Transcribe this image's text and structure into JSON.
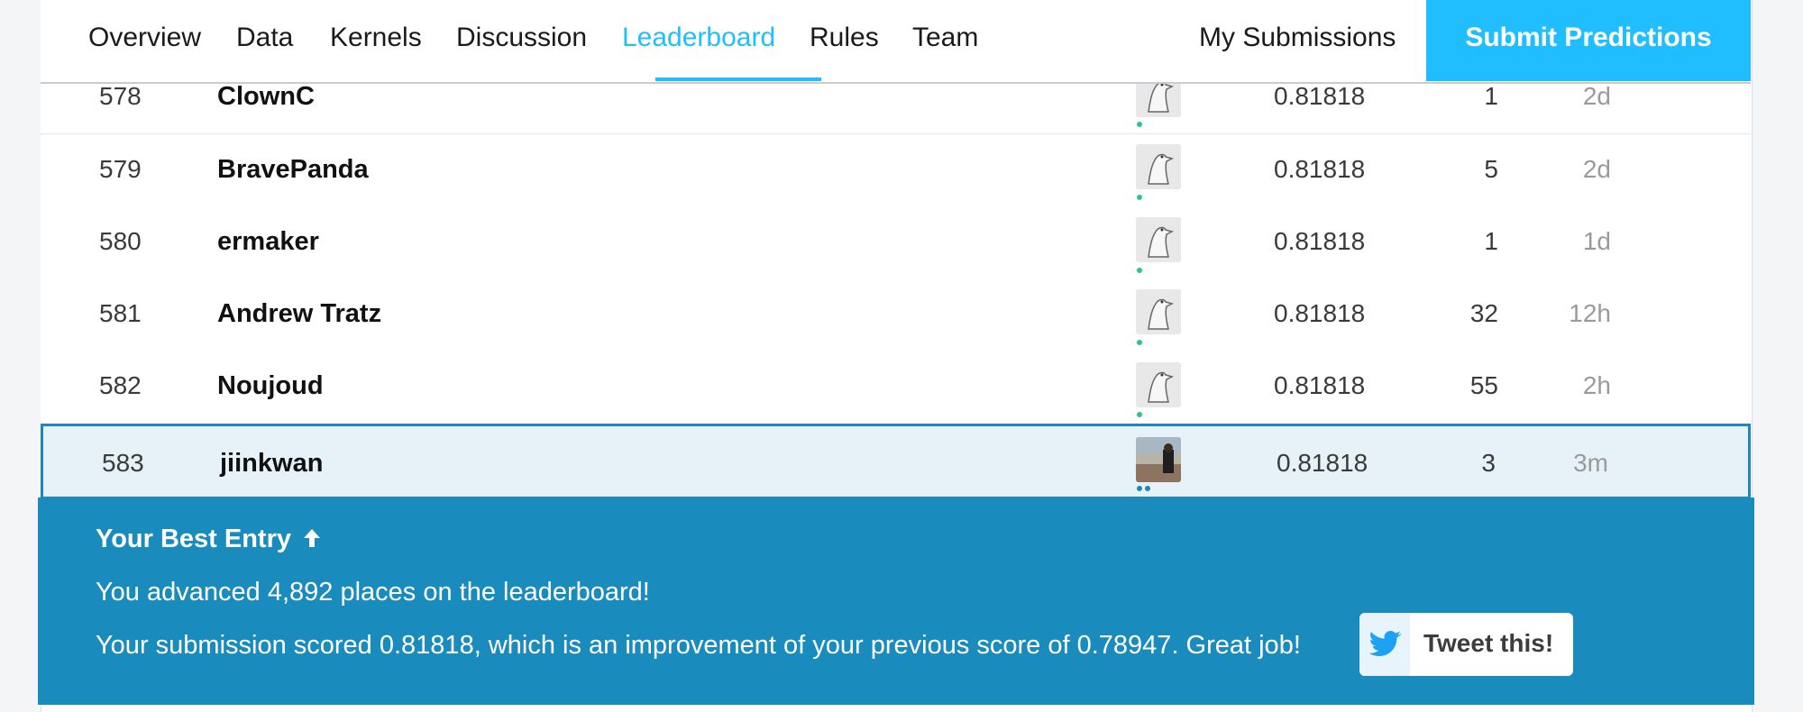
{
  "tabs": [
    {
      "label": "Overview",
      "active": false
    },
    {
      "label": "Data",
      "active": false
    },
    {
      "label": "Kernels",
      "active": false
    },
    {
      "label": "Discussion",
      "active": false
    },
    {
      "label": "Leaderboard",
      "active": true
    },
    {
      "label": "Rules",
      "active": false
    },
    {
      "label": "Team",
      "active": false
    }
  ],
  "header": {
    "my_submissions": "My Submissions",
    "submit_predictions": "Submit Predictions"
  },
  "rows": [
    {
      "rank": "578",
      "name": "ClownC",
      "score": "0.81818",
      "entries": "1",
      "last": "2d",
      "avatar": "goose-avatar"
    },
    {
      "rank": "579",
      "name": "BravePanda",
      "score": "0.81818",
      "entries": "5",
      "last": "2d",
      "avatar": "goose-avatar"
    },
    {
      "rank": "580",
      "name": "ermaker",
      "score": "0.81818",
      "entries": "1",
      "last": "1d",
      "avatar": "goose-avatar"
    },
    {
      "rank": "581",
      "name": "Andrew Tratz",
      "score": "0.81818",
      "entries": "32",
      "last": "12h",
      "avatar": "goose-avatar"
    },
    {
      "rank": "582",
      "name": "Noujoud",
      "score": "0.81818",
      "entries": "55",
      "last": "2h",
      "avatar": "goose-avatar"
    },
    {
      "rank": "583",
      "name": "jiinkwan",
      "score": "0.81818",
      "entries": "3",
      "last": "3m",
      "avatar": "photo-avatar",
      "highlight": true
    }
  ],
  "best_entry": {
    "title": "Your Best Entry",
    "arrow_icon": "arrow-up-icon",
    "advanced": "You advanced 4,892 places on the leaderboard!",
    "scored": "Your submission scored 0.81818, which is an improvement of your previous score of 0.78947. Great job!",
    "tweet_label": "Tweet this!",
    "tweet_icon": "twitter-bird-icon"
  },
  "colors": {
    "accent": "#20beff",
    "banner": "#1a8bbd",
    "highlight_row": "#e6f2f8"
  }
}
